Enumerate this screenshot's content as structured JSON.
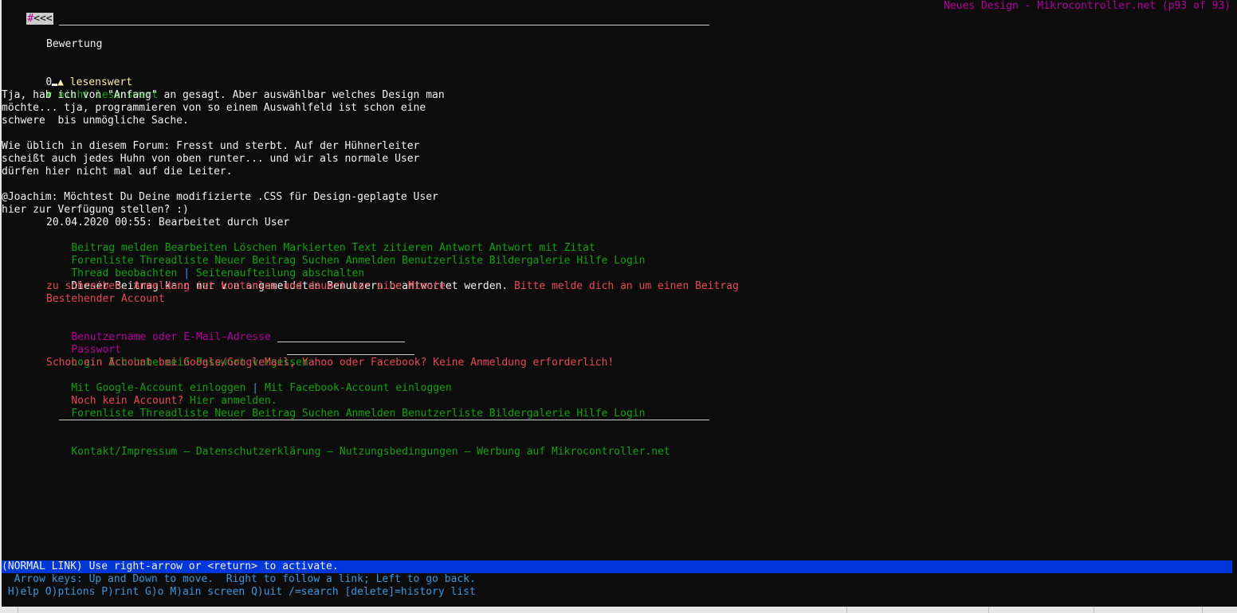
{
  "window": {
    "back_hash": "#",
    "back_arrows": "<<<",
    "title": "Neues Design - Mikrocontroller.net (p93 of 93)"
  },
  "rating": {
    "heading": "Bewertung",
    "score": "0",
    "up_icon": "▲",
    "up_label": "lesenswert",
    "down_icon": "▼",
    "down_label": "nicht lesenswert"
  },
  "post": {
    "lines": [
      "Tja, hab ich von \"Anfang\" an gesagt. Aber auswählbar welches Design man",
      "möchte... tja, programmieren von so einem Auswahlfeld ist schon eine",
      "schwere  bis unmögliche Sache.",
      "",
      "Wie üblich in diesem Forum: Fresst und sterbt. Auf der Hühnerleiter",
      "scheißt auch jedes Huhn von oben runter... und wir als normale User",
      "dürfen hier nicht mal auf die Leiter.",
      "",
      "@Joachim: Möchtest Du Deine modifizierte .CSS für Design-geplagte User",
      "hier zur Verfügung stellen? :)"
    ],
    "edited": "20.04.2020 00:55: Bearbeitet durch User"
  },
  "post_actions": [
    "Beitrag melden",
    "Bearbeiten",
    "Löschen",
    "Markierten Text zitieren",
    "Antwort",
    "Antwort mit Zitat"
  ],
  "nav_top": [
    "Forenliste",
    "Threadliste",
    "Neuer Beitrag",
    "Suchen",
    "Anmelden",
    "Benutzerliste",
    "Bildergalerie",
    "Hilfe",
    "Login"
  ],
  "thread_links": {
    "watch": "Thread beobachten",
    "sep": "|",
    "paging": "Seitenaufteilung abschalten"
  },
  "login_notice": {
    "text": "Dieser Beitrag kann nur von angemeldeten Benutzern beantwortet werden.",
    "red1": "Bitte melde dich an um einen Beitrag",
    "red2": "zu schreiben. Anmeldung ist kostenlos und dauert nur eine Minute."
  },
  "login_form": {
    "account_heading": "Bestehender Account",
    "username_label": "Benutzername oder E-Mail-Adresse",
    "password_label": "Passwort",
    "login_button": "Login",
    "forgot_link": "Ich habe mein Passwort vergessen",
    "social_notice": "Schon ein Account bei Google/GoogleMail, Yahoo oder Facebook? Keine Anmeldung erforderlich!",
    "google_login": "Mit Google-Account einloggen",
    "social_sep": "|",
    "facebook_login": "Mit Facebook-Account einloggen",
    "no_account": "Noch kein Account?",
    "register_link": "Hier anmelden."
  },
  "nav_bottom": [
    "Forenliste",
    "Threadliste",
    "Neuer Beitrag",
    "Suchen",
    "Anmelden",
    "Benutzerliste",
    "Bildergalerie",
    "Hilfe",
    "Login"
  ],
  "footer": {
    "links": [
      "Kontakt/Impressum",
      "Datenschutzerklärung",
      "Nutzungsbedingungen",
      "Werbung auf Mikrocontroller.net"
    ],
    "sep": "–"
  },
  "statusbar": {
    "text": "(NORMAL LINK) Use right-arrow or <return> to activate."
  },
  "help": {
    "line1": "  Arrow keys: Up and Down to move.  Right to follow a link; Left to go back.",
    "line2": " H)elp O)ptions P)rint G)o M)ain screen Q)uit /=search [delete]=history list"
  },
  "colors": {
    "background": "#0c0c0c",
    "text": "#cccccc",
    "link": "#13a10e",
    "alert": "#e74856",
    "form_label": "#b4009e",
    "status_bar": "#0037da"
  }
}
